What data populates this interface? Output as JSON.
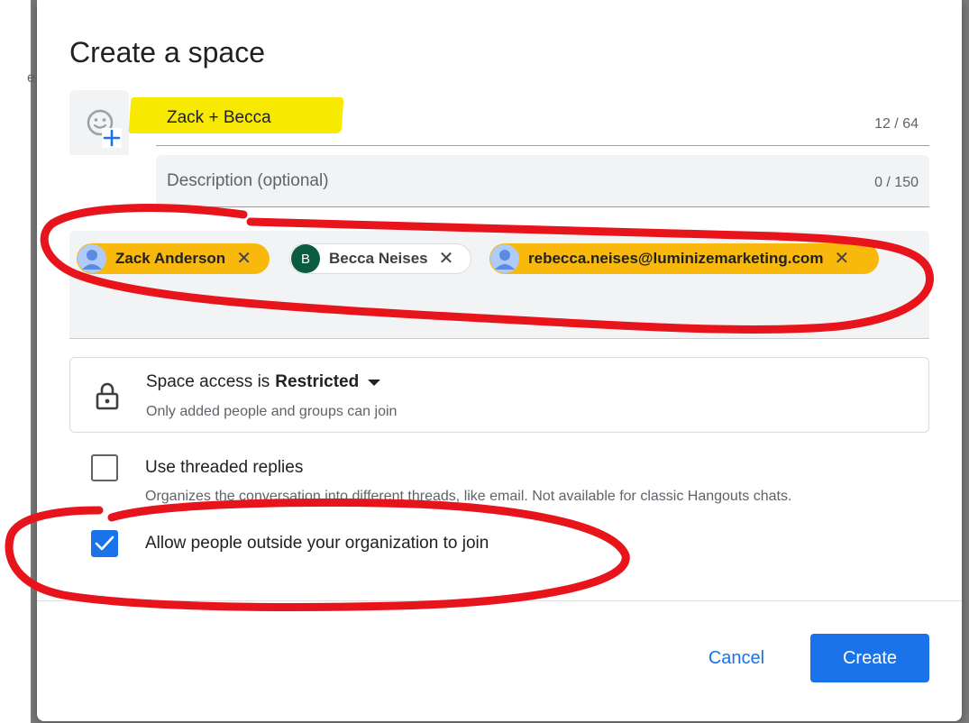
{
  "background": {
    "fragment_text": "e"
  },
  "dialog": {
    "title": "Create a space",
    "name_field": {
      "value": "Zack + Becca",
      "counter": "12 / 64"
    },
    "description_field": {
      "placeholder": "Description (optional)",
      "counter": "0 / 150"
    },
    "people": [
      {
        "label": "Zack Anderson",
        "avatar": "person-icon",
        "style": "highlighted"
      },
      {
        "label": "Becca Neises",
        "avatar_letter": "B",
        "style": "default"
      },
      {
        "label": "rebecca.neises@luminizemarketing.com",
        "avatar": "person-icon",
        "style": "highlighted"
      }
    ],
    "access": {
      "prefix": "Space access is",
      "value": "Restricted",
      "description": "Only added people and groups can join"
    },
    "options": [
      {
        "label": "Use threaded replies",
        "description": "Organizes the conversation into different threads, like email. Not available for classic Hangouts chats.",
        "checked": false
      },
      {
        "label": "Allow people outside your organization to join",
        "checked": true
      }
    ],
    "buttons": {
      "cancel": "Cancel",
      "create": "Create"
    }
  },
  "colors": {
    "primary": "#1a73e8",
    "chip_highlight": "#f8b80c",
    "text_highlight": "#f7ea00",
    "annotation": "#e8141b",
    "avatar_b": "#0b5b3e"
  }
}
